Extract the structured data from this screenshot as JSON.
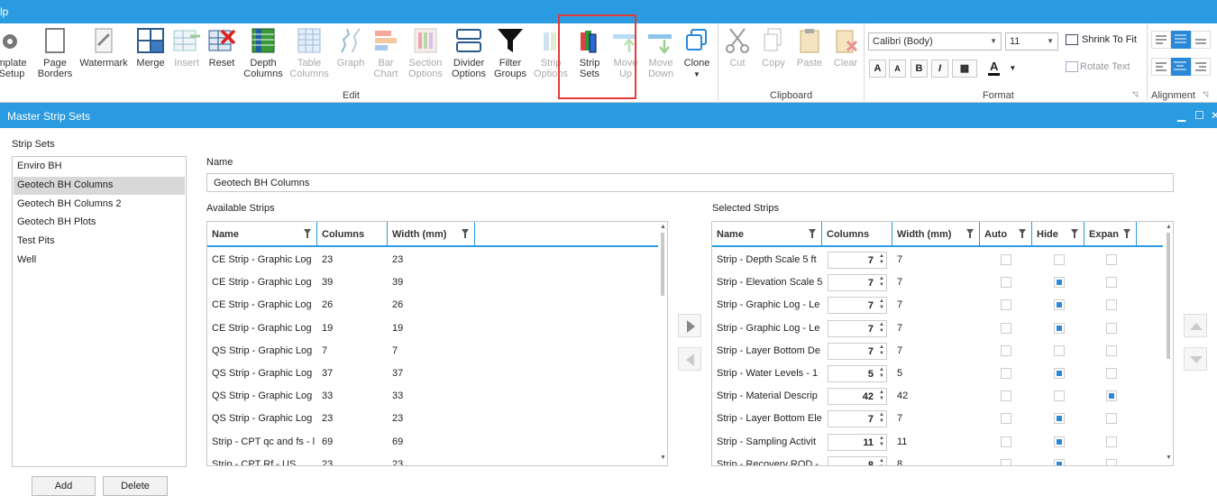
{
  "app": {
    "menu_fragment": "lp"
  },
  "ribbon": {
    "edit_buttons": [
      {
        "label": "mplate\nSetup",
        "enabled": true
      },
      {
        "label": "Page\nBorders",
        "enabled": true
      },
      {
        "label": "Watermark",
        "enabled": true
      },
      {
        "label": "Merge",
        "enabled": true
      },
      {
        "label": "Insert",
        "enabled": false
      },
      {
        "label": "Reset",
        "enabled": true
      },
      {
        "label": "Depth\nColumns",
        "enabled": true
      },
      {
        "label": "Table\nColumns",
        "enabled": false
      },
      {
        "label": "Graph",
        "enabled": false
      },
      {
        "label": "Bar\nChart",
        "enabled": false
      },
      {
        "label": "Section\nOptions",
        "enabled": false
      },
      {
        "label": "Divider\nOptions",
        "enabled": true
      },
      {
        "label": "Filter\nGroups",
        "enabled": true
      },
      {
        "label": "Strip\nOptions",
        "enabled": false
      },
      {
        "label": "Strip\nSets",
        "enabled": true
      },
      {
        "label": "Move\nUp",
        "enabled": false
      },
      {
        "label": "Move\nDown",
        "enabled": false
      },
      {
        "label": "Clone",
        "enabled": true
      }
    ],
    "clipboard_buttons": [
      {
        "label": "Cut",
        "enabled": false
      },
      {
        "label": "Copy",
        "enabled": false
      },
      {
        "label": "Paste",
        "enabled": false
      },
      {
        "label": "Clear",
        "enabled": false
      }
    ],
    "groups": {
      "edit": "Edit",
      "clipboard": "Clipboard",
      "format": "Format",
      "alignment": "Alignment"
    },
    "format": {
      "font_family": "Calibri (Body)",
      "font_size": "11",
      "shrink_to_fit": "Shrink To Fit",
      "rotate_text": "Rotate Text",
      "bold": "B",
      "italic": "I",
      "font_color_letter": "A"
    }
  },
  "dialog": {
    "title": "Master Strip Sets",
    "strip_sets_label": "Strip Sets",
    "strip_sets": [
      "Enviro BH",
      "Geotech BH Columns",
      "Geotech BH Columns 2",
      "Geotech BH Plots",
      "Test Pits",
      "Well"
    ],
    "name_label": "Name",
    "name_value": "Geotech BH Columns",
    "available_label": "Available Strips",
    "selected_label": "Selected Strips",
    "available_headers": [
      "Name",
      "Columns",
      "Width (mm)"
    ],
    "available_rows": [
      {
        "name": "CE Strip - Graphic Log",
        "columns": "23",
        "width": "23"
      },
      {
        "name": "CE Strip - Graphic Log",
        "columns": "39",
        "width": "39"
      },
      {
        "name": "CE Strip - Graphic Log",
        "columns": "26",
        "width": "26"
      },
      {
        "name": "CE Strip - Graphic Log",
        "columns": "19",
        "width": "19"
      },
      {
        "name": "QS Strip - Graphic Log",
        "columns": "7",
        "width": "7"
      },
      {
        "name": "QS Strip - Graphic Log",
        "columns": "37",
        "width": "37"
      },
      {
        "name": "QS Strip - Graphic Log",
        "columns": "33",
        "width": "33"
      },
      {
        "name": "QS Strip - Graphic Log",
        "columns": "23",
        "width": "23"
      },
      {
        "name": "Strip - CPT qc and fs - l",
        "columns": "69",
        "width": "69"
      },
      {
        "name": "Strip - CPT Rf - US",
        "columns": "23",
        "width": "23"
      }
    ],
    "selected_headers": [
      "Name",
      "Columns",
      "Width (mm)",
      "Auto",
      "Hide",
      "Expan"
    ],
    "selected_rows": [
      {
        "name": "Strip - Depth Scale 5 ft",
        "columns": "7",
        "width": "7",
        "auto": false,
        "hide": false,
        "expand": false
      },
      {
        "name": "Strip - Elevation Scale 5",
        "columns": "7",
        "width": "7",
        "auto": false,
        "hide": true,
        "expand": false
      },
      {
        "name": "Strip - Graphic Log - Le",
        "columns": "7",
        "width": "7",
        "auto": false,
        "hide": true,
        "expand": false
      },
      {
        "name": "Strip - Graphic Log - Le",
        "columns": "7",
        "width": "7",
        "auto": false,
        "hide": true,
        "expand": false
      },
      {
        "name": "Strip - Layer Bottom De",
        "columns": "7",
        "width": "7",
        "auto": false,
        "hide": false,
        "expand": false
      },
      {
        "name": "Strip - Water Levels - 1",
        "columns": "5",
        "width": "5",
        "auto": false,
        "hide": true,
        "expand": false
      },
      {
        "name": "Strip - Material Descrip",
        "columns": "42",
        "width": "42",
        "auto": false,
        "hide": false,
        "expand": true
      },
      {
        "name": "Strip - Layer Bottom Ele",
        "columns": "7",
        "width": "7",
        "auto": false,
        "hide": true,
        "expand": false
      },
      {
        "name": "Strip - Sampling Activit",
        "columns": "11",
        "width": "11",
        "auto": false,
        "hide": true,
        "expand": false
      },
      {
        "name": "Strip - Recovery RQD -",
        "columns": "8",
        "width": "8",
        "auto": false,
        "hide": true,
        "expand": false
      }
    ],
    "bottom_buttons": [
      "Add",
      "Delete"
    ]
  },
  "colors": {
    "accent": "#2a9be0",
    "highlight": "#e23a3a",
    "checked": "#2a8ad8"
  }
}
